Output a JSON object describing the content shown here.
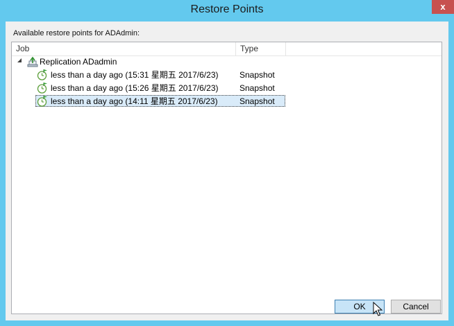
{
  "window": {
    "title": "Restore Points",
    "close_glyph": "x"
  },
  "caption": "Available restore points for ADAdmin:",
  "columns": {
    "job": "Job",
    "type": "Type"
  },
  "tree": {
    "job_label": "Replication ADadmin",
    "job_icon": "replication-job-icon",
    "restore_points": [
      {
        "label": "less than a day ago (15:31 星期五 2017/6/23)",
        "type": "Snapshot",
        "icon": "restore-point-clock-icon"
      },
      {
        "label": "less than a day ago (15:26 星期五 2017/6/23)",
        "type": "Snapshot",
        "icon": "restore-point-clock-icon"
      },
      {
        "label": "less than a day ago (14:11 星期五 2017/6/23)",
        "type": "Snapshot",
        "icon": "restore-point-clock-icon"
      }
    ],
    "selected_index": 2
  },
  "buttons": {
    "ok": "OK",
    "cancel": "Cancel"
  },
  "colors": {
    "title_bar": "#63c9ee",
    "close_button": "#c7514f",
    "selection": "#d9ebf9",
    "ok_button": "#c7e4f7"
  }
}
